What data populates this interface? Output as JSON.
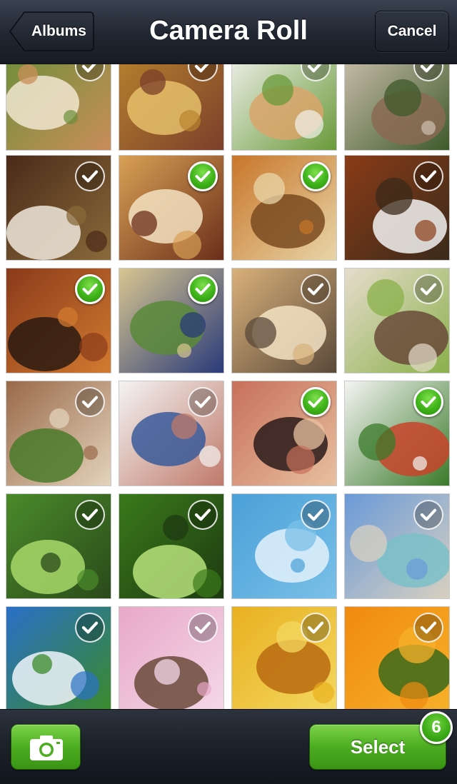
{
  "navbar": {
    "title": "Camera Roll",
    "back_label": "Albums",
    "cancel_label": "Cancel"
  },
  "grid": {
    "tiles": [
      {
        "name": "bread-plate",
        "checked": false,
        "colors": [
          "#6b8f3a",
          "#f1e6d0",
          "#c98d5a"
        ]
      },
      {
        "name": "quiche-plate",
        "checked": false,
        "colors": [
          "#b9832d",
          "#e6c06b",
          "#7a3f2a"
        ]
      },
      {
        "name": "pasta-white-plate",
        "checked": false,
        "colors": [
          "#f2f2ee",
          "#d9a56b",
          "#6a9a3a"
        ]
      },
      {
        "name": "pasta-cream-plate",
        "checked": false,
        "colors": [
          "#cfc1b0",
          "#8a6a52",
          "#3d5a2a"
        ]
      },
      {
        "name": "stew-rice-plate",
        "checked": false,
        "colors": [
          "#4a2a18",
          "#efe7dc",
          "#8a6a3a"
        ]
      },
      {
        "name": "fried-cutlet-plate",
        "checked": true,
        "colors": [
          "#d9a055",
          "#f3e2c2",
          "#6b2f1a"
        ]
      },
      {
        "name": "steamed-dumpling",
        "checked": true,
        "colors": [
          "#c8762a",
          "#7a4a1e",
          "#e8d5a8"
        ]
      },
      {
        "name": "hamburger",
        "checked": false,
        "colors": [
          "#8a3c18",
          "#f2f2f2",
          "#3a2a1a"
        ]
      },
      {
        "name": "paella-pan",
        "checked": true,
        "colors": [
          "#8a3a1a",
          "#2a1a12",
          "#d27a30"
        ]
      },
      {
        "name": "noodle-soup",
        "checked": true,
        "colors": [
          "#d8c690",
          "#5a8a3a",
          "#2a3a7a"
        ]
      },
      {
        "name": "baguette-pieces",
        "checked": false,
        "colors": [
          "#d9b07a",
          "#f3e3c3",
          "#5a4a3a"
        ]
      },
      {
        "name": "salad-plates",
        "checked": false,
        "colors": [
          "#e6dccc",
          "#6a4a3a",
          "#8ab04a"
        ]
      },
      {
        "name": "grilled-meat-broccoli",
        "checked": false,
        "colors": [
          "#9a6a4a",
          "#4a7a2a",
          "#e3d3bb"
        ]
      },
      {
        "name": "blue-bowl-dish",
        "checked": false,
        "colors": [
          "#f3f3f3",
          "#3a5a9a",
          "#c07a6a"
        ]
      },
      {
        "name": "prosciutto-olives",
        "checked": true,
        "colors": [
          "#c7705a",
          "#2a1a1a",
          "#e8c0a0"
        ]
      },
      {
        "name": "tomato-pasta-plate",
        "checked": true,
        "colors": [
          "#f4f4f2",
          "#c8442a",
          "#3a7a2a"
        ]
      },
      {
        "name": "tree-canopy",
        "checked": false,
        "colors": [
          "#4a8a2a",
          "#a8d86a",
          "#2a4a1a"
        ]
      },
      {
        "name": "green-leaves",
        "checked": false,
        "colors": [
          "#3a7a1a",
          "#b7e27a",
          "#1e3a12"
        ]
      },
      {
        "name": "blue-sky-clouds",
        "checked": false,
        "colors": [
          "#4aa0d8",
          "#e3f1fa",
          "#7ac0e8"
        ]
      },
      {
        "name": "beach-sea",
        "checked": false,
        "colors": [
          "#6a9ad8",
          "#7ac0c8",
          "#d8d0c0"
        ]
      },
      {
        "name": "sky-field",
        "checked": false,
        "colors": [
          "#2a70c8",
          "#f0f4fa",
          "#3a8a2a"
        ]
      },
      {
        "name": "pink-blossoms",
        "checked": false,
        "colors": [
          "#e8a8c8",
          "#6a4a3a",
          "#f4d8e8"
        ]
      },
      {
        "name": "yellow-maple",
        "checked": false,
        "colors": [
          "#e8b020",
          "#b86a10",
          "#f4d860"
        ]
      },
      {
        "name": "orange-cosmos",
        "checked": false,
        "colors": [
          "#f08a10",
          "#3a6a1a",
          "#f7b02a"
        ]
      }
    ]
  },
  "toolbar": {
    "select_label": "Select",
    "selected_count": "6",
    "camera_icon": "camera-icon"
  },
  "theme": {
    "accent_green": "#4cad20",
    "bar_dark": "#1d222b"
  }
}
